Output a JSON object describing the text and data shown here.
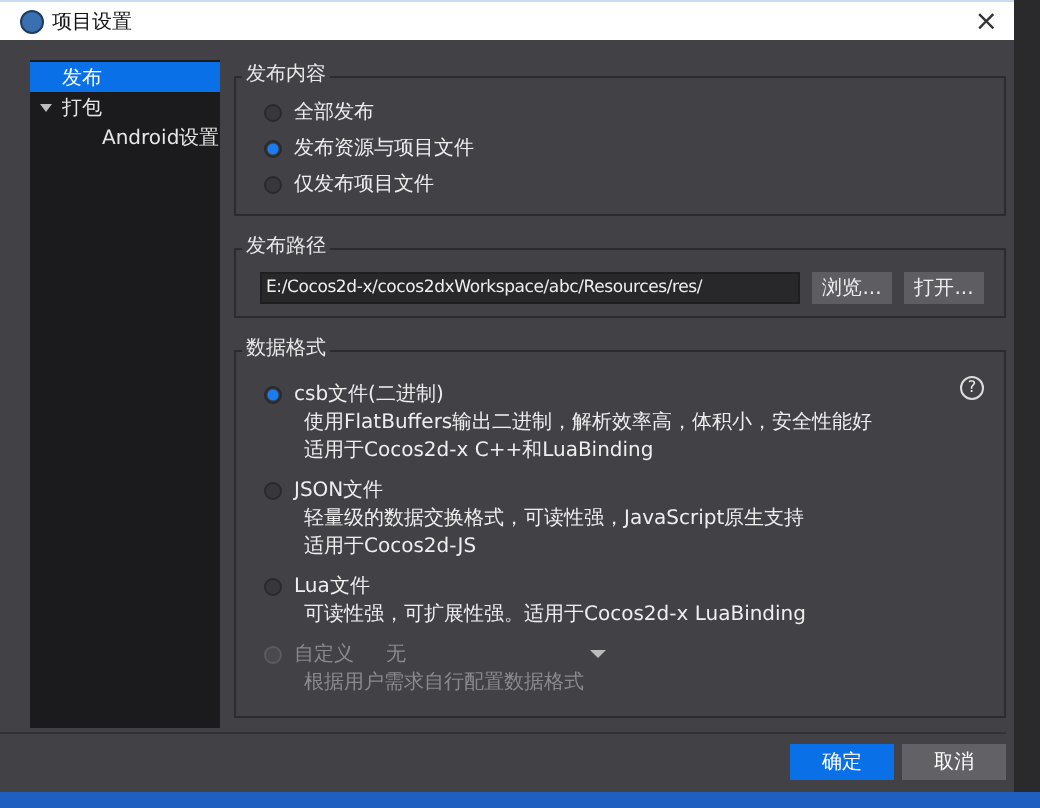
{
  "window": {
    "title": "项目设置",
    "close": "×"
  },
  "sidebar": {
    "items": [
      {
        "label": "发布",
        "selected": true
      },
      {
        "label": "打包",
        "selected": false,
        "expanded": true,
        "children": [
          {
            "label": "Android设置",
            "selected": false
          }
        ]
      }
    ]
  },
  "publish_content": {
    "title": "发布内容",
    "options": [
      {
        "label": "全部发布",
        "selected": false
      },
      {
        "label": "发布资源与项目文件",
        "selected": true
      },
      {
        "label": "仅发布项目文件",
        "selected": false
      }
    ]
  },
  "publish_path": {
    "title": "发布路径",
    "value": "E:/Cocos2d-x/cocos2dxWorkspace/abc/Resources/res/",
    "buttons": [
      "浏览...",
      "打开..."
    ]
  },
  "data_format": {
    "title": "数据格式",
    "help": "?",
    "options": [
      {
        "kind": "plain",
        "label": "csb文件(二进制)",
        "selected": true,
        "disabled": false,
        "description": [
          "使用FlatBuffers输出二进制，解析效率高，体积小，安全性能好",
          "适用于Cocos2d-x C++和LuaBinding"
        ]
      },
      {
        "kind": "plain",
        "label": "JSON文件",
        "selected": false,
        "disabled": false,
        "description": [
          "轻量级的数据交换格式，可读性强，JavaScript原生支持",
          "适用于Cocos2d-JS"
        ]
      },
      {
        "kind": "plain",
        "label": "Lua文件",
        "selected": false,
        "disabled": false,
        "description": [
          "可读性强，可扩展性强。适用于Cocos2d-x LuaBinding"
        ]
      },
      {
        "kind": "custom",
        "label": "自定义",
        "selected": false,
        "disabled": true,
        "dropdown": "无",
        "description": [
          "根据用户需求自行配置数据格式"
        ]
      }
    ]
  },
  "buttons": [
    {
      "label": "确定",
      "primary": true
    },
    {
      "label": "取消",
      "primary": false
    }
  ]
}
